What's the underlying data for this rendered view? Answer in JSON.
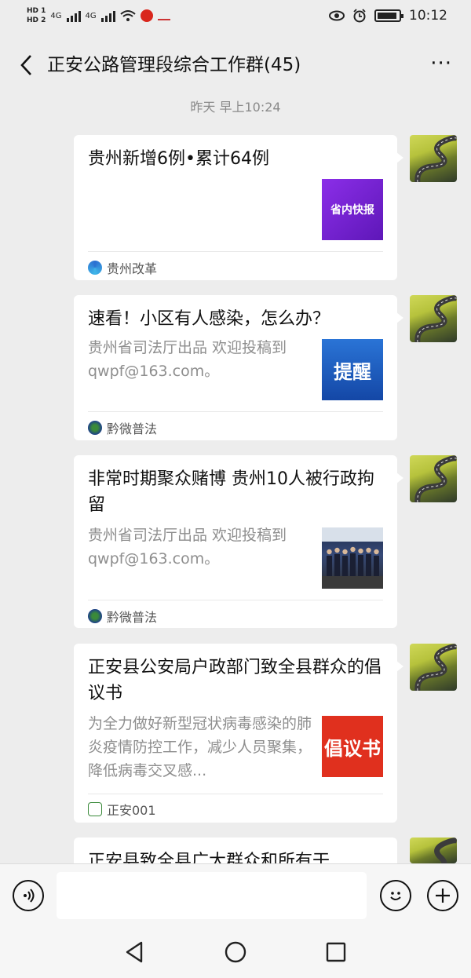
{
  "status_bar": {
    "hd1": "HD 1",
    "hd2": "HD 2",
    "net1": "4G",
    "net2": "4G",
    "time": "10:12",
    "icons": [
      "eye-icon",
      "alarm-icon",
      "battery-icon",
      "wifi-icon",
      "notification-app-icon"
    ]
  },
  "header": {
    "back_icon": "chevron-left-icon",
    "title": "正安公路管理段综合工作群(45)",
    "more_label": "···"
  },
  "timestamp": "昨天 早上10:24",
  "messages": [
    {
      "title": "贵州新增6例•累计64例",
      "description": "",
      "thumb_text": "省内快报",
      "thumb_color": "#7a22d6",
      "source": "贵州改革"
    },
    {
      "title": "速看！小区有人感染，怎么办？",
      "description": "贵州省司法厅出品 欢迎投稿到qwpf@163.com。",
      "thumb_text": "提醒",
      "thumb_color": "#1f5fbf",
      "source": "黔微普法"
    },
    {
      "title": "非常时期聚众赌博 贵州10人被行政拘留",
      "description": "贵州省司法厅出品 欢迎投稿到qwpf@163.com。",
      "thumb_text": "",
      "thumb_color": "#2a3350",
      "source": "黔微普法"
    },
    {
      "title": "正安县公安局户政部门致全县群众的倡议书",
      "description": "为全力做好新型冠状病毒感染的肺炎疫情防控工作，减少人员聚集，降低病毒交叉感...",
      "thumb_text": "倡议书",
      "thumb_color": "#e0301e",
      "source": "正安001"
    },
    {
      "title": "正安县致全县广大群众和所有干",
      "description": "",
      "thumb_text": "",
      "thumb_color": "",
      "source": ""
    }
  ],
  "input_bar": {
    "voice_icon": "voice-icon",
    "emoji_icon": "emoji-icon",
    "plus_icon": "plus-icon"
  },
  "system_nav": [
    "back-triangle-icon",
    "home-circle-icon",
    "recents-square-icon"
  ]
}
